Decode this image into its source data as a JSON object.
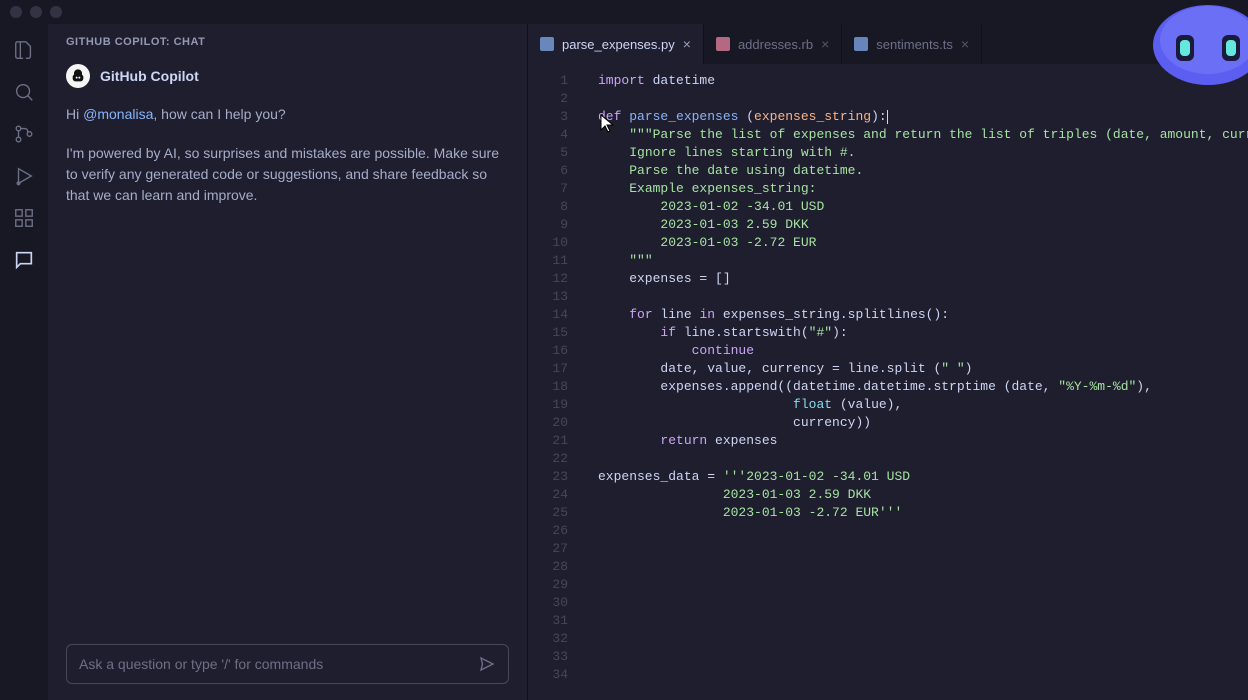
{
  "chat": {
    "header": "GITHUB COPILOT: CHAT",
    "author": "GitHub Copilot",
    "greeting_pre": "Hi ",
    "greeting_mention": "@monalisa",
    "greeting_post": ", how can I help you?",
    "disclaimer": "I'm powered by AI, so surprises and mistakes are possible. Make sure to verify any generated code or suggestions, and share feedback so that we can learn and improve.",
    "input_placeholder": "Ask a question or type '/' for commands"
  },
  "tabs": [
    {
      "label": "parse_expenses.py",
      "icon": "python",
      "active": true
    },
    {
      "label": "addresses.rb",
      "icon": "ruby",
      "active": false
    },
    {
      "label": "sentiments.ts",
      "icon": "typescript",
      "active": false
    }
  ],
  "code": {
    "lines": [
      [
        {
          "t": "kw",
          "v": "import"
        },
        {
          "t": "plain",
          "v": " datetime"
        }
      ],
      [],
      [
        {
          "t": "kw",
          "v": "def"
        },
        {
          "t": "plain",
          "v": " "
        },
        {
          "t": "fn",
          "v": "parse_expenses"
        },
        {
          "t": "plain",
          "v": " ("
        },
        {
          "t": "param",
          "v": "expenses_string"
        },
        {
          "t": "plain",
          "v": "):"
        },
        {
          "t": "cursor",
          "v": ""
        }
      ],
      [
        {
          "t": "plain",
          "v": "    "
        },
        {
          "t": "str",
          "v": "\"\"\"Parse the list of expenses and return the list of triples (date, amount, currency"
        }
      ],
      [
        {
          "t": "plain",
          "v": "    "
        },
        {
          "t": "str",
          "v": "Ignore lines starting with #."
        }
      ],
      [
        {
          "t": "plain",
          "v": "    "
        },
        {
          "t": "str",
          "v": "Parse the date using datetime."
        }
      ],
      [
        {
          "t": "plain",
          "v": "    "
        },
        {
          "t": "str",
          "v": "Example expenses_string:"
        }
      ],
      [
        {
          "t": "plain",
          "v": "        "
        },
        {
          "t": "str",
          "v": "2023-01-02 -34.01 USD"
        }
      ],
      [
        {
          "t": "plain",
          "v": "        "
        },
        {
          "t": "str",
          "v": "2023-01-03 2.59 DKK"
        }
      ],
      [
        {
          "t": "plain",
          "v": "        "
        },
        {
          "t": "str",
          "v": "2023-01-03 -2.72 EUR"
        }
      ],
      [
        {
          "t": "plain",
          "v": "    "
        },
        {
          "t": "str",
          "v": "\"\"\""
        }
      ],
      [
        {
          "t": "plain",
          "v": "    expenses = []"
        }
      ],
      [],
      [
        {
          "t": "plain",
          "v": "    "
        },
        {
          "t": "kw",
          "v": "for"
        },
        {
          "t": "plain",
          "v": " line "
        },
        {
          "t": "kw",
          "v": "in"
        },
        {
          "t": "plain",
          "v": " expenses_string.splitlines():"
        }
      ],
      [
        {
          "t": "plain",
          "v": "        "
        },
        {
          "t": "kw",
          "v": "if"
        },
        {
          "t": "plain",
          "v": " line.startswith("
        },
        {
          "t": "str",
          "v": "\"#\""
        },
        {
          "t": "plain",
          "v": "):"
        }
      ],
      [
        {
          "t": "plain",
          "v": "            "
        },
        {
          "t": "kw",
          "v": "continue"
        }
      ],
      [
        {
          "t": "plain",
          "v": "        date, value, currency = line.split ("
        },
        {
          "t": "str",
          "v": "\" \""
        },
        {
          "t": "plain",
          "v": ")"
        }
      ],
      [
        {
          "t": "plain",
          "v": "        expenses.append((datetime.datetime.strptime (date, "
        },
        {
          "t": "str",
          "v": "\"%Y-%m-%d\""
        },
        {
          "t": "plain",
          "v": "),"
        }
      ],
      [
        {
          "t": "plain",
          "v": "                         "
        },
        {
          "t": "builtin",
          "v": "float"
        },
        {
          "t": "plain",
          "v": " (value),"
        }
      ],
      [
        {
          "t": "plain",
          "v": "                         currency))"
        }
      ],
      [
        {
          "t": "plain",
          "v": "        "
        },
        {
          "t": "kw",
          "v": "return"
        },
        {
          "t": "plain",
          "v": " expenses"
        }
      ],
      [],
      [
        {
          "t": "plain",
          "v": "expenses_data = "
        },
        {
          "t": "str",
          "v": "'''2023-01-02 -34.01 USD"
        }
      ],
      [
        {
          "t": "plain",
          "v": "                "
        },
        {
          "t": "str",
          "v": "2023-01-03 2.59 DKK"
        }
      ],
      [
        {
          "t": "plain",
          "v": "                "
        },
        {
          "t": "str",
          "v": "2023-01-03 -2.72 EUR'''"
        }
      ],
      [],
      [],
      [],
      [],
      [],
      [],
      [],
      [],
      []
    ]
  }
}
